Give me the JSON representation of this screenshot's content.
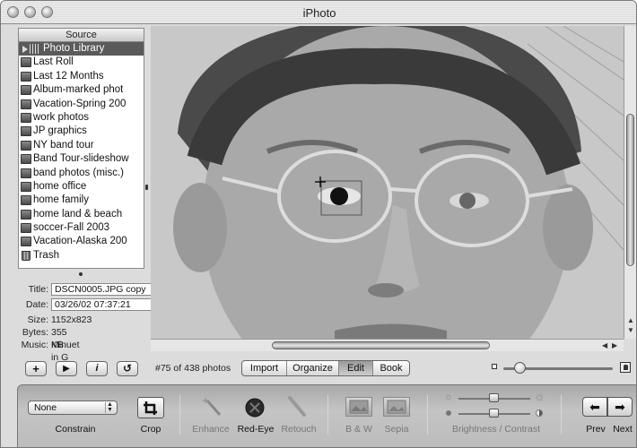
{
  "window": {
    "title": "iPhoto"
  },
  "source": {
    "header": "Source",
    "items": [
      {
        "label": "Photo Library",
        "icon": "photo-library-icon",
        "selected": true
      },
      {
        "label": "Last Roll",
        "icon": "last-roll-icon"
      },
      {
        "label": "Last 12 Months",
        "icon": "calendar-icon"
      },
      {
        "label": "Album-marked phot",
        "icon": "album-icon"
      },
      {
        "label": "Vacation-Spring 200",
        "icon": "album-icon"
      },
      {
        "label": "work photos",
        "icon": "album-icon"
      },
      {
        "label": "JP graphics",
        "icon": "album-icon"
      },
      {
        "label": "NY band tour",
        "icon": "album-icon"
      },
      {
        "label": "Band Tour-slideshow",
        "icon": "album-icon"
      },
      {
        "label": "band photos (misc.)",
        "icon": "album-icon"
      },
      {
        "label": "home office",
        "icon": "album-icon"
      },
      {
        "label": "home family",
        "icon": "album-icon"
      },
      {
        "label": "home land & beach",
        "icon": "album-icon"
      },
      {
        "label": "soccer-Fall 2003",
        "icon": "album-icon"
      },
      {
        "label": "Vacation-Alaska 200",
        "icon": "album-icon"
      },
      {
        "label": "Trash",
        "icon": "trash-icon"
      }
    ]
  },
  "info": {
    "title_label": "Title:",
    "title_value": "DSCN0005.JPG copy",
    "date_label": "Date:",
    "date_value": "03/26/02  07:37:21",
    "size_label": "Size:",
    "size_value": "1152x823",
    "bytes_label": "Bytes:",
    "bytes_value": "355 KB",
    "music_label": "Music:",
    "music_value": "Minuet in G"
  },
  "controls": {
    "add_label": "+",
    "play_label": "▶",
    "info_label": "i",
    "rotate_label": "↺",
    "photo_count": "#75 of 438 photos",
    "modes": [
      {
        "label": "Import",
        "active": false
      },
      {
        "label": "Organize",
        "active": false
      },
      {
        "label": "Edit",
        "active": true
      },
      {
        "label": "Book",
        "active": false
      }
    ],
    "zoom_level": 0.15
  },
  "edit": {
    "constrain_value": "None",
    "constrain_label": "Constrain",
    "crop_label": "Crop",
    "enhance_label": "Enhance",
    "redeye_label": "Red-Eye",
    "retouch_label": "Retouch",
    "bw_label": "B & W",
    "sepia_label": "Sepia",
    "brightness_contrast_label": "Brightness / Contrast",
    "prev_label": "Prev",
    "next_label": "Next"
  },
  "colors": {
    "selection": "#5a5a5a",
    "toolbar": "#bdbdbd"
  }
}
